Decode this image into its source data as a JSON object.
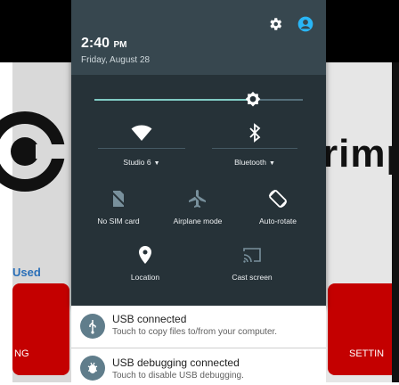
{
  "background_app": {
    "used_label": "Used",
    "wordmark": "rimp",
    "left_button_label": "NG",
    "right_button_label": "SETTIN"
  },
  "status": {
    "time": "2:40",
    "ampm": "PM",
    "date": "Friday, August 28"
  },
  "header_icons": [
    "settings-icon",
    "user-icon"
  ],
  "brightness": {
    "level": 0.76
  },
  "tiles": {
    "wifi": {
      "label": "Studio 6",
      "icon": "wifi-icon"
    },
    "bluetooth": {
      "label": "Bluetooth",
      "icon": "bluetooth-icon"
    },
    "sim": {
      "label": "No SIM card",
      "icon": "no-sim-icon"
    },
    "airplane": {
      "label": "Airplane mode",
      "icon": "airplane-icon"
    },
    "rotate": {
      "label": "Auto-rotate",
      "icon": "auto-rotate-icon"
    },
    "location": {
      "label": "Location",
      "icon": "location-icon"
    },
    "cast": {
      "label": "Cast screen",
      "icon": "cast-icon"
    }
  },
  "notifications": [
    {
      "title": "USB connected",
      "subtitle": "Touch to copy files to/from your computer.",
      "icon": "usb-icon"
    },
    {
      "title": "USB debugging connected",
      "subtitle": "Touch to disable USB debugging.",
      "icon": "bug-icon"
    }
  ],
  "colors": {
    "shade_bg": "#263238",
    "header_bg": "#37474f",
    "accent": "#80cbc4",
    "user_icon": "#29b6f6",
    "app_red": "#c40000"
  }
}
